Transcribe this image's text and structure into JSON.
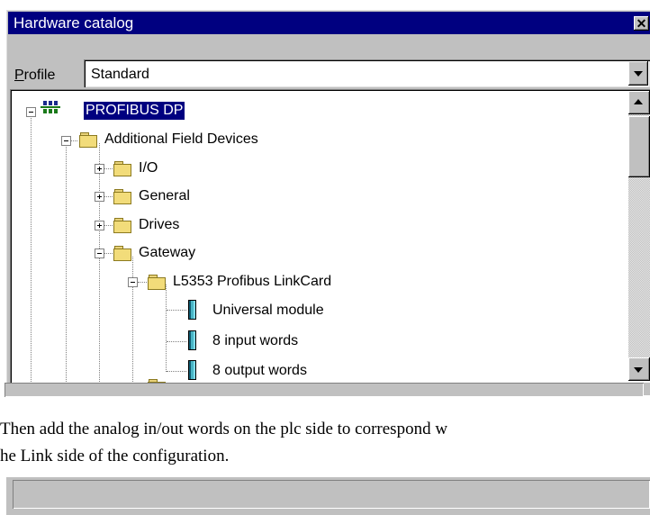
{
  "window": {
    "title": "Hardware catalog",
    "close_glyph": "✕"
  },
  "profile": {
    "label_prefix": "P",
    "label_rest": "rofile",
    "value": "Standard"
  },
  "tree": {
    "root": {
      "label": "PROFIBUS DP",
      "icon": "network-icon",
      "selected": true,
      "expanded": true
    },
    "additional": {
      "label": "Additional Field Devices",
      "icon": "folder-icon",
      "expanded": true
    },
    "io": {
      "label": "I/O",
      "icon": "folder-icon",
      "expanded": false
    },
    "general": {
      "label": "General",
      "icon": "folder-icon",
      "expanded": false
    },
    "drives": {
      "label": "Drives",
      "icon": "folder-icon",
      "expanded": false
    },
    "gateway": {
      "label": "Gateway",
      "icon": "folder-icon",
      "expanded": true
    },
    "linkcard": {
      "label": "L5353 Profibus LinkCard",
      "icon": "folder-icon",
      "expanded": true
    },
    "universal": {
      "label": "Universal module",
      "icon": "module-icon"
    },
    "input": {
      "label": "8 input words",
      "icon": "module-icon"
    },
    "output": {
      "label": "8 output words",
      "icon": "module-icon"
    }
  },
  "caption": {
    "line1": "Then add the analog in/out words on the plc side to correspond w",
    "line2": "he Link side of the configuration."
  },
  "colors": {
    "titlebar": "#000080",
    "selection": "#000080",
    "face": "#c0c0c0"
  }
}
